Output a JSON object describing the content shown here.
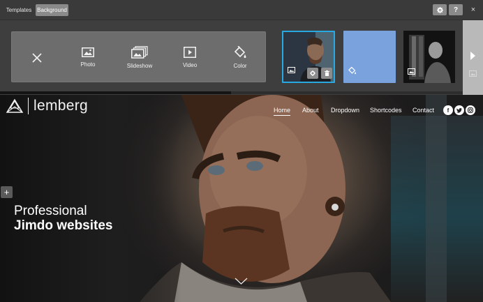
{
  "editor": {
    "tabs": {
      "templates": "Templates",
      "background": "Background"
    },
    "top_actions": {
      "help_label": "?",
      "close_label": "×"
    },
    "sources": [
      {
        "label": "",
        "icon": "close-icon"
      },
      {
        "label": "Photo",
        "icon": "photo-icon"
      },
      {
        "label": "Slideshow",
        "icon": "slideshow-icon"
      },
      {
        "label": "Video",
        "icon": "video-icon"
      },
      {
        "label": "Color",
        "icon": "paint-bucket-icon"
      }
    ],
    "thumbnails": [
      {
        "type": "photo",
        "selected": true
      },
      {
        "type": "color",
        "color": "#7aa3de"
      },
      {
        "type": "photo"
      }
    ],
    "colors": {
      "accent": "#29a9e1",
      "panel": "#3e3e3e",
      "source_box": "#6d6d6d"
    }
  },
  "site": {
    "logo": {
      "text": "lemberg"
    },
    "nav": {
      "home": "Home",
      "about": "About",
      "dropdown": "Dropdown",
      "shortcodes": "Shortcodes",
      "contact": "Contact"
    },
    "social": {
      "facebook": "f",
      "twitter": "t",
      "instagram": "o"
    },
    "add_button": "+",
    "headline": {
      "line1": "Professional",
      "line2": "Jimdo websites"
    }
  }
}
